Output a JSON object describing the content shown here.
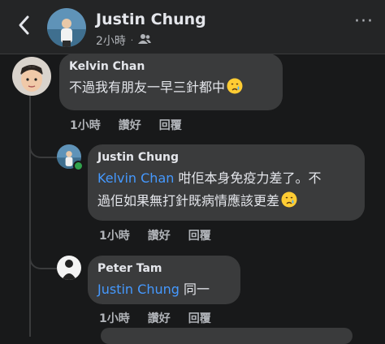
{
  "header": {
    "name": "Justin Chung",
    "time": "2小時",
    "separator": "·",
    "more": "···"
  },
  "comments": [
    {
      "author": "Kelvin Chan",
      "text": "不過我有朋友一早三針都中",
      "emoji": "sad-crying-face",
      "actions": {
        "time": "1小時",
        "like": "讚好",
        "reply": "回覆"
      }
    },
    {
      "author": "Justin Chung",
      "mention": "Kelvin Chan",
      "text_line1": "咁佢本身免疫力差了。不",
      "text_line2": "過佢如果無打針既病情應該更差",
      "emoji": "sad-crying-face",
      "actions": {
        "time": "1小時",
        "like": "讚好",
        "reply": "回覆"
      }
    },
    {
      "author": "Peter Tam",
      "mention": "Justin Chung",
      "text": "同一",
      "actions": {
        "time": "1小時",
        "like": "讚好",
        "reply": "回覆"
      }
    }
  ],
  "colors": {
    "background": "#18191a",
    "bubble": "#3a3b3c",
    "mention": "#4599ff",
    "online": "#31a24c"
  }
}
